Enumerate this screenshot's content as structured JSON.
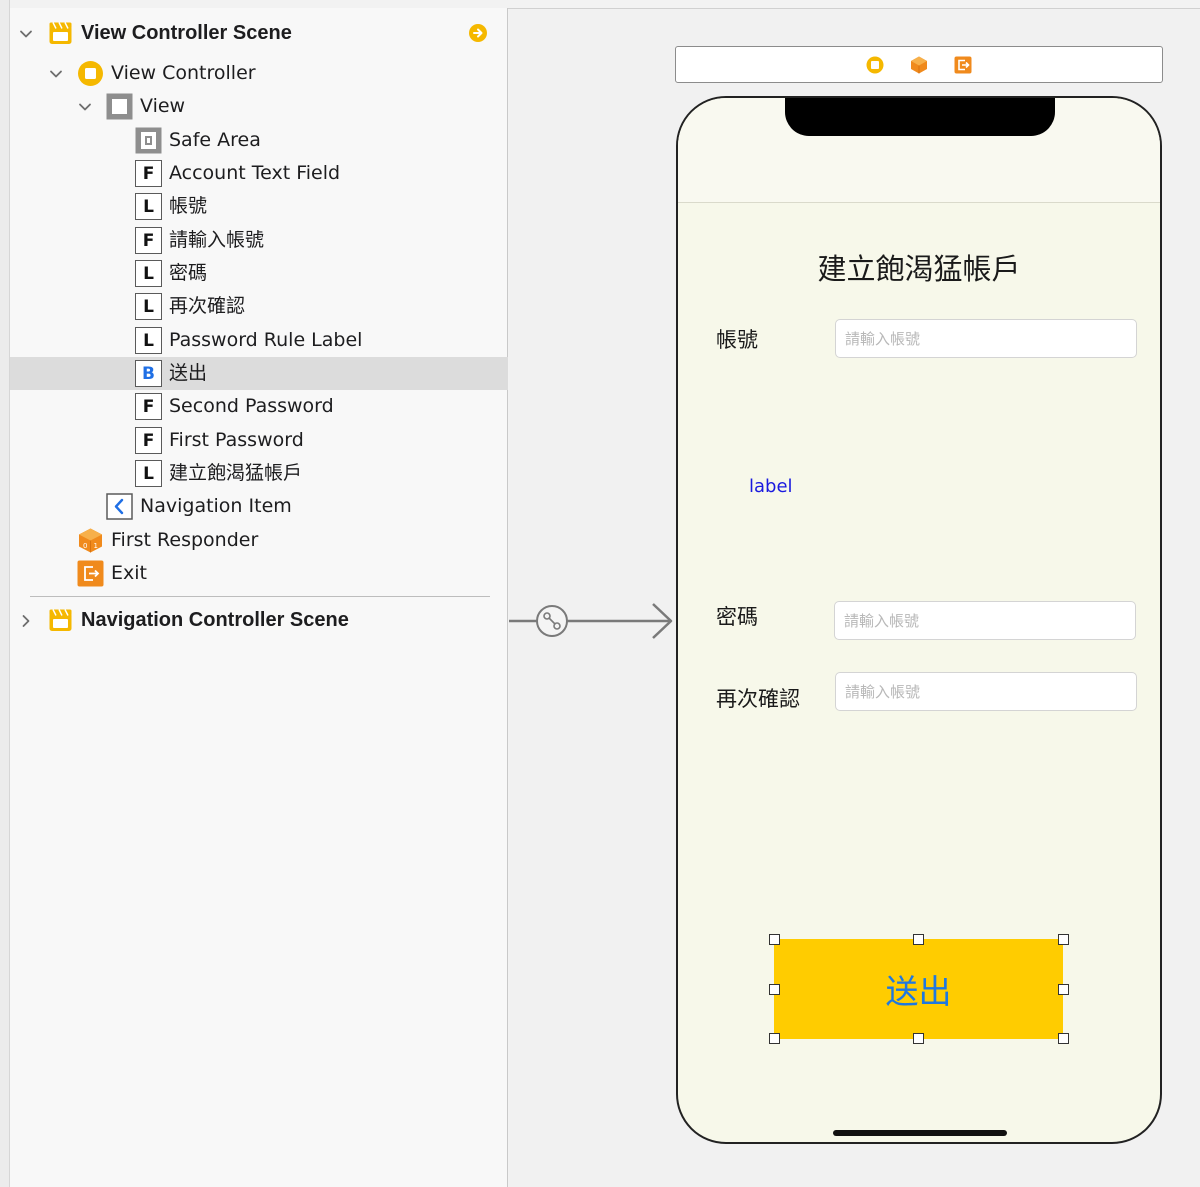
{
  "outline": {
    "scenes": [
      {
        "title": "View Controller Scene",
        "expanded": true,
        "icon": "scene-icon",
        "items": [
          {
            "label": "View Controller",
            "icon": "view-controller-icon",
            "level": 1,
            "expanded": true
          },
          {
            "label": "View",
            "icon": "view-icon",
            "level": 2,
            "expanded": true
          },
          {
            "label": "Safe Area",
            "icon": "safe-area-icon",
            "level": 3
          },
          {
            "label": "Account Text Field",
            "icon": "F",
            "level": 3
          },
          {
            "label": "帳號",
            "icon": "L",
            "level": 3
          },
          {
            "label": "請輸入帳號",
            "icon": "F",
            "level": 3
          },
          {
            "label": "密碼",
            "icon": "L",
            "level": 3
          },
          {
            "label": "再次確認",
            "icon": "L",
            "level": 3
          },
          {
            "label": "Password Rule Label",
            "icon": "L",
            "level": 3
          },
          {
            "label": "送出",
            "icon": "B",
            "level": 3,
            "selected": true
          },
          {
            "label": "Second Password",
            "icon": "F",
            "level": 3
          },
          {
            "label": "First Password",
            "icon": "F",
            "level": 3
          },
          {
            "label": "建立飽渴猛帳戶",
            "icon": "L",
            "level": 3
          },
          {
            "label": "Navigation Item",
            "icon": "navigation-item-icon",
            "level": 2
          },
          {
            "label": "First Responder",
            "icon": "first-responder-icon",
            "level": 1
          },
          {
            "label": "Exit",
            "icon": "exit-icon",
            "level": 1
          }
        ]
      },
      {
        "title": "Navigation Controller Scene",
        "expanded": false,
        "icon": "scene-icon"
      }
    ]
  },
  "canvas": {
    "dock_icons": [
      "view-controller-icon",
      "first-responder-icon",
      "exit-icon"
    ],
    "screen": {
      "title": "建立飽渴猛帳戶",
      "account_label": "帳號",
      "account_placeholder": "請輸入帳號",
      "password_rule_label": "label",
      "password_label": "密碼",
      "password_placeholder": "請輸入帳號",
      "confirm_label": "再次確認",
      "confirm_placeholder": "請輸入帳號",
      "submit_button": "送出"
    }
  },
  "colors": {
    "accent_orange": "#f5a623",
    "button_fill": "#ffcc00",
    "button_text": "#1f78e0",
    "rule_label": "#1a1adf",
    "screen_background": "#f7f8ea",
    "selection": "#dcdcdc"
  }
}
